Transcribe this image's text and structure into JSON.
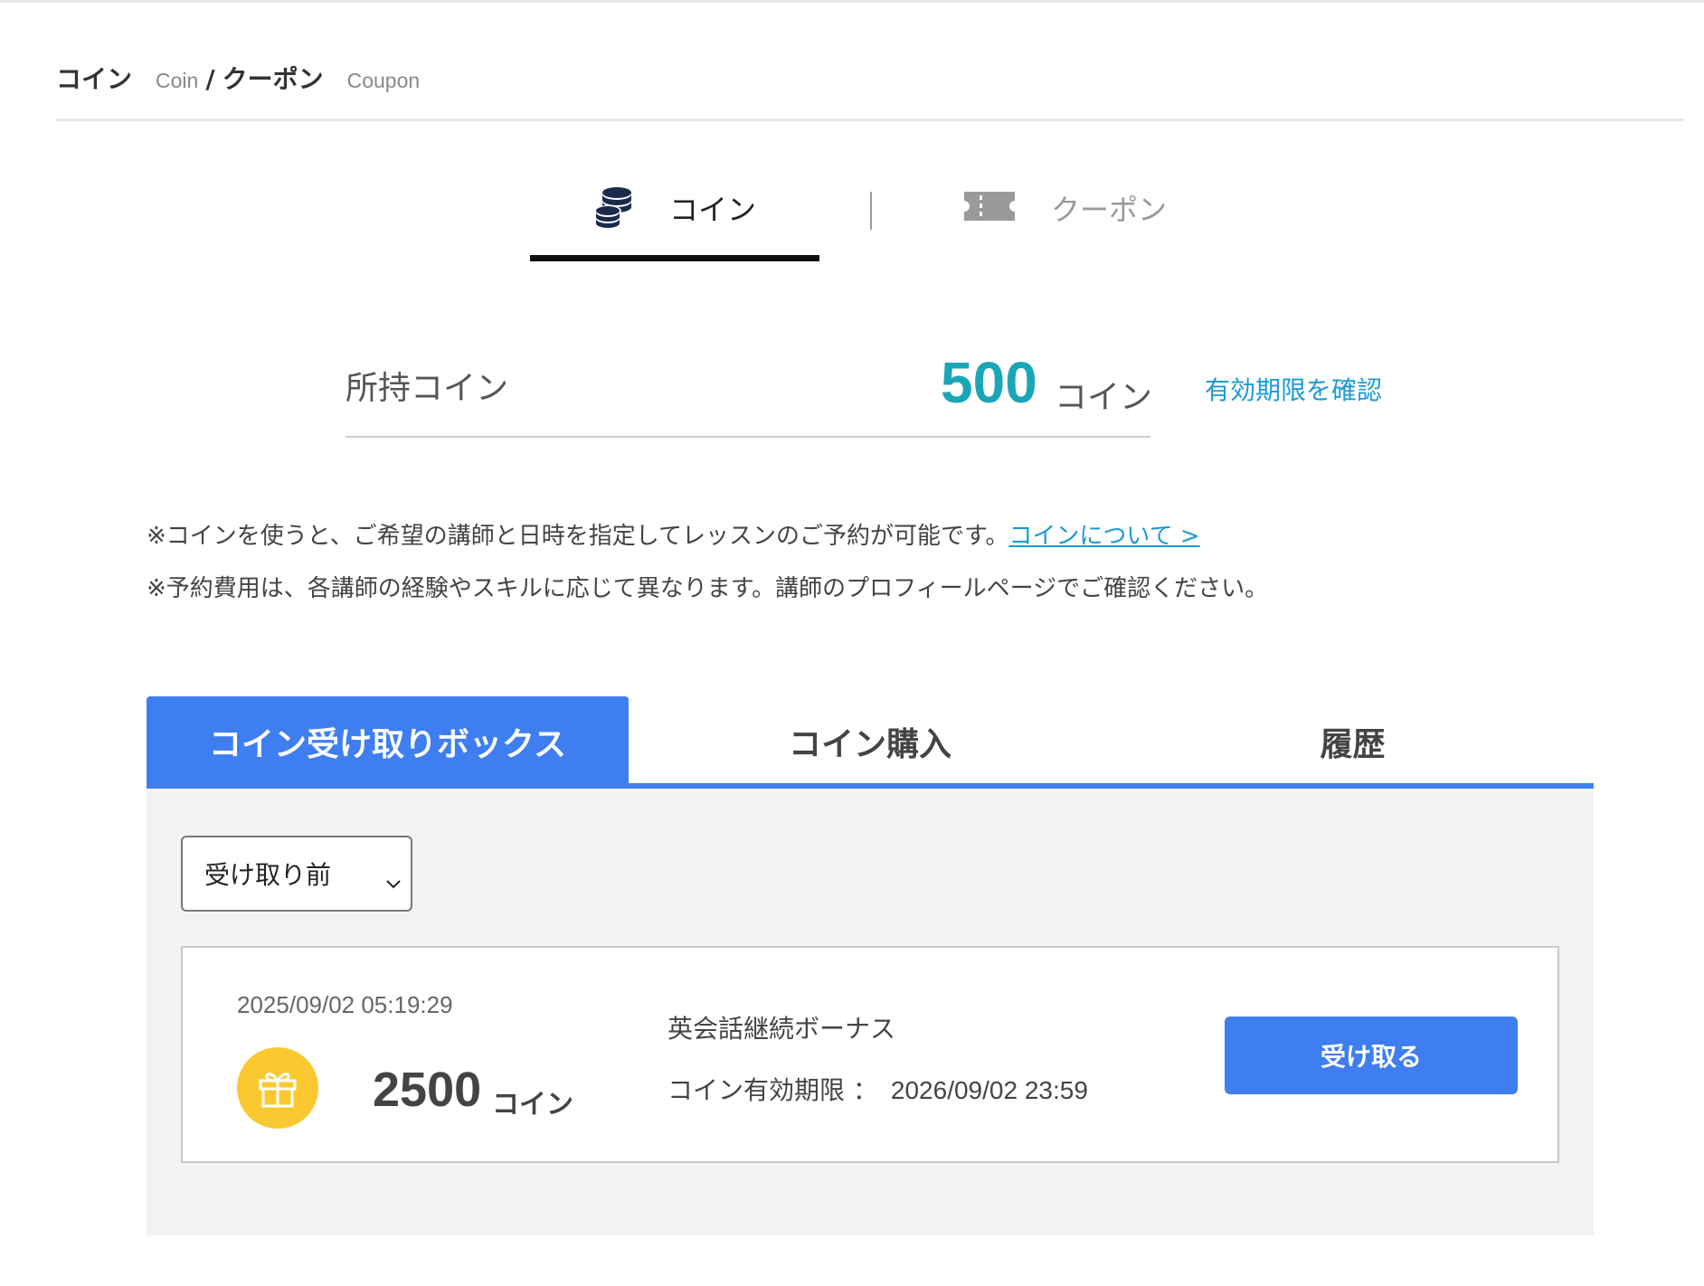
{
  "heading": {
    "coin_jp": "コイン",
    "coin_en": "Coin",
    "slash": "/",
    "coupon_jp": "クーポン",
    "coupon_en": "Coupon"
  },
  "main_tabs": [
    {
      "label": "コイン",
      "icon": "coins-icon",
      "active": true
    },
    {
      "label": "クーポン",
      "icon": "ticket-icon",
      "active": false
    }
  ],
  "balance": {
    "label": "所持コイン",
    "value": "500",
    "unit": "コイン",
    "expiry_link": "有効期限を確認"
  },
  "notes": {
    "line1": "※コインを使うと、ご希望の講師と日時を指定してレッスンのご予約が可能です。",
    "line1_link": "コインについて >",
    "line2": "※予約費用は、各講師の経験やスキルに応じて異なります。講師のプロフィールページでご確認ください。"
  },
  "sub_tabs": [
    {
      "label": "コイン受け取りボックス",
      "active": true
    },
    {
      "label": "コイン購入",
      "active": false
    },
    {
      "label": "履歴",
      "active": false
    }
  ],
  "filter": {
    "selected": "受け取り前"
  },
  "items": [
    {
      "date": "2025/09/02 05:19:29",
      "icon": "gift-icon",
      "amount": "2500",
      "unit": "コイン",
      "title": "英会話継続ボーナス",
      "expiry_label": "コイン有効期限 ：",
      "expiry_value": "2026/09/02 23:59",
      "button": "受け取る"
    }
  ],
  "colors": {
    "accent_blue": "#3e7ef1",
    "balance_teal": "#1aa6b7",
    "link_blue": "#1a9ad6",
    "gift_yellow": "#fbc92f"
  }
}
